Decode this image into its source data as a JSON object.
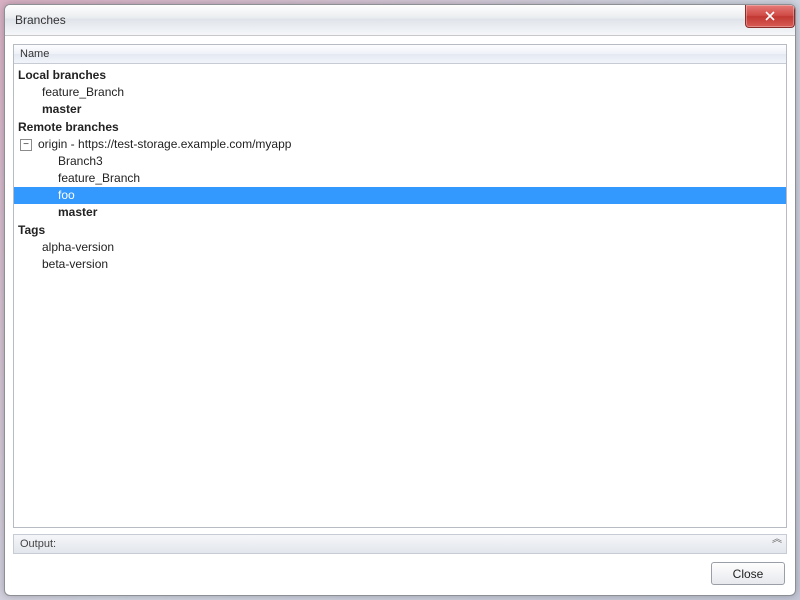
{
  "window": {
    "title": "Branches"
  },
  "tree": {
    "header": "Name",
    "sections": {
      "local": {
        "title": "Local branches",
        "items": [
          {
            "label": "feature_Branch",
            "bold": false
          },
          {
            "label": "master",
            "bold": true
          }
        ]
      },
      "remote": {
        "title": "Remote branches",
        "origin_label": "origin - https://test-storage.example.com/myapp",
        "expander": "−",
        "items": [
          {
            "label": "Branch3",
            "bold": false,
            "selected": false
          },
          {
            "label": "feature_Branch",
            "bold": false,
            "selected": false
          },
          {
            "label": "foo",
            "bold": false,
            "selected": true
          },
          {
            "label": "master",
            "bold": true,
            "selected": false
          }
        ]
      },
      "tags": {
        "title": "Tags",
        "items": [
          {
            "label": "alpha-version"
          },
          {
            "label": "beta-version"
          }
        ]
      }
    }
  },
  "output": {
    "label": "Output:"
  },
  "buttons": {
    "close": "Close"
  }
}
